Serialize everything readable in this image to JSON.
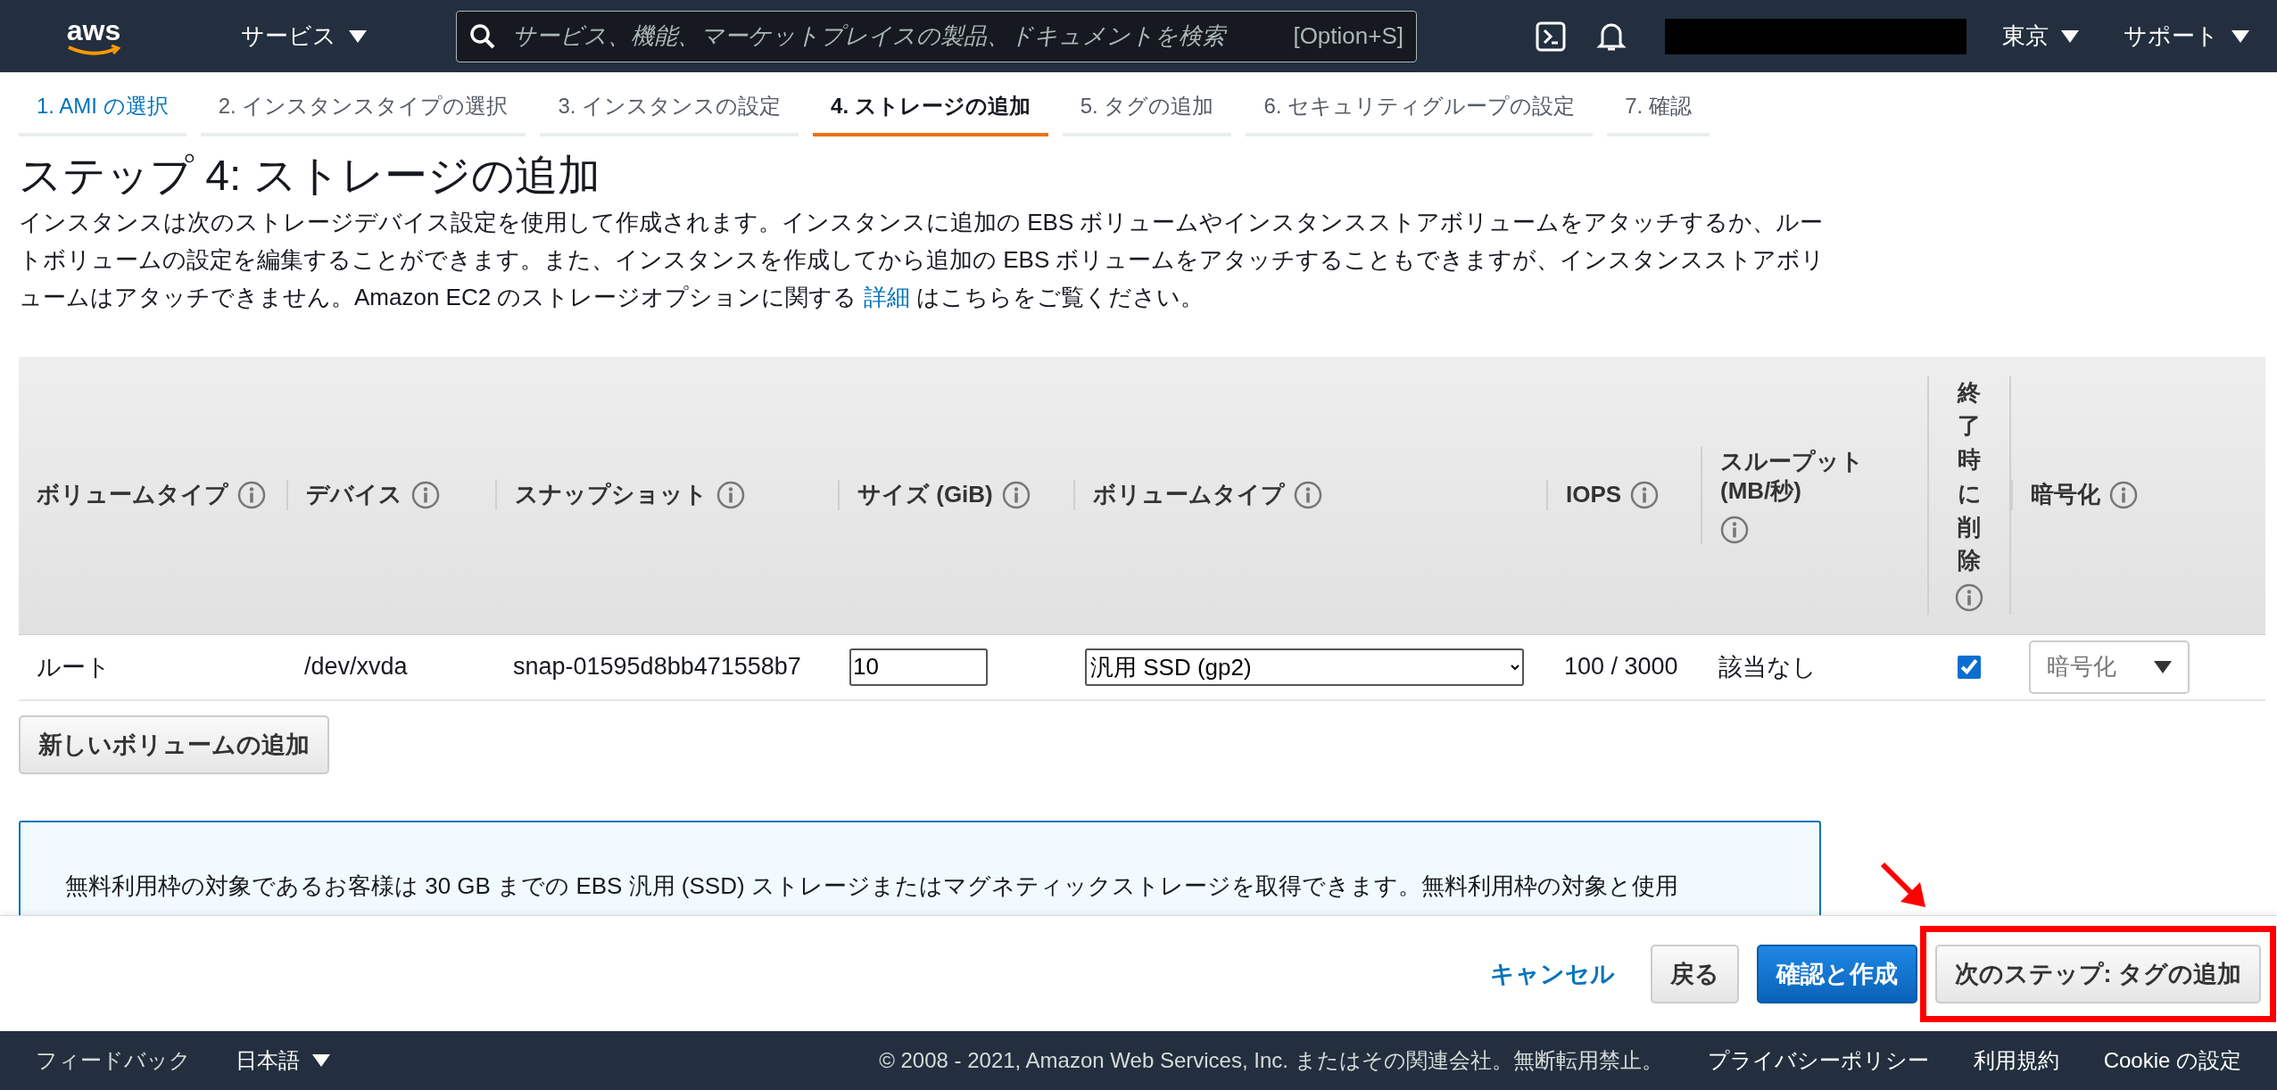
{
  "top_bar": {
    "logo": "aws",
    "services_menu": "サービス",
    "search": {
      "placeholder": "サービス、機能、マーケットプレイスの製品、ドキュメントを検索",
      "shortcut": "[Option+S]"
    },
    "region_menu": "東京",
    "support_menu": "サポート"
  },
  "tabs": [
    {
      "label": "1. AMI の選択",
      "selected": false,
      "done": true
    },
    {
      "label": "2. インスタンスタイプの選択",
      "selected": false,
      "done": false
    },
    {
      "label": "3. インスタンスの設定",
      "selected": false,
      "done": false
    },
    {
      "label": "4. ストレージの追加",
      "selected": true,
      "done": false
    },
    {
      "label": "5. タグの追加",
      "selected": false,
      "done": false
    },
    {
      "label": "6. セキュリティグループの設定",
      "selected": false,
      "done": false
    },
    {
      "label": "7. 確認",
      "selected": false,
      "done": false
    }
  ],
  "page_title": "ステップ 4: ストレージの追加",
  "description": {
    "before": "インスタンスは次のストレージデバイス設定を使用して作成されます。インスタンスに追加の EBS ボリュームやインスタンスストアボリュームをアタッチするか、ルートボリュームの設定を編集することができます。また、インスタンスを作成してから追加の EBS ボリュームをアタッチすることもできますが、インスタンスストアボリュームはアタッチできません。Amazon EC2 のストレージオプションに関する ",
    "link": "詳細",
    "after": " はこちらをご覧ください。"
  },
  "table": {
    "columns": [
      {
        "label": "ボリュームタイプ",
        "kind": "text"
      },
      {
        "label": "デバイス",
        "kind": "text"
      },
      {
        "label": "スナップショット",
        "kind": "text"
      },
      {
        "label": "サイズ (GiB)",
        "kind": "text"
      },
      {
        "label": "ボリュームタイプ",
        "kind": "text"
      },
      {
        "label": "IOPS",
        "kind": "text"
      },
      {
        "label": "スループット (MB/秒)",
        "kind": "text"
      },
      {
        "label": "終了時に削除",
        "kind": "vertical"
      },
      {
        "label": "暗号化",
        "kind": "text"
      }
    ],
    "rows": [
      {
        "volume_type": "ルート",
        "device": "/dev/xvda",
        "snapshot": "snap-01595d8bb471558b7",
        "size": "10",
        "type_select": "汎用 SSD (gp2)",
        "iops": "100 / 3000",
        "throughput": "該当なし",
        "delete_on_termination": true,
        "encryption": "暗号化"
      }
    ]
  },
  "add_volume_button": "新しいボリュームの追加",
  "info_box": {
    "text": "無料利用枠の対象であるお客様は 30 GB までの EBS 汎用 (SSD) ストレージまたはマグネティックストレージを取得できます。無料利用枠の対象と使用"
  },
  "actions": [
    {
      "label": "キャンセル",
      "kind": "link",
      "highlighted": false
    },
    {
      "label": "戻る",
      "kind": "secondary",
      "highlighted": false
    },
    {
      "label": "確認と作成",
      "kind": "primary",
      "highlighted": false
    },
    {
      "label": "次のステップ: タグの追加",
      "kind": "secondary",
      "highlighted": true
    }
  ],
  "footer": {
    "feedback": "フィードバック",
    "language": "日本語",
    "copyright": "© 2008 - 2021, Amazon Web Services, Inc. またはその関連会社。無断転用禁止。",
    "links": [
      "プライバシーポリシー",
      "利用規約",
      "Cookie の設定"
    ]
  }
}
